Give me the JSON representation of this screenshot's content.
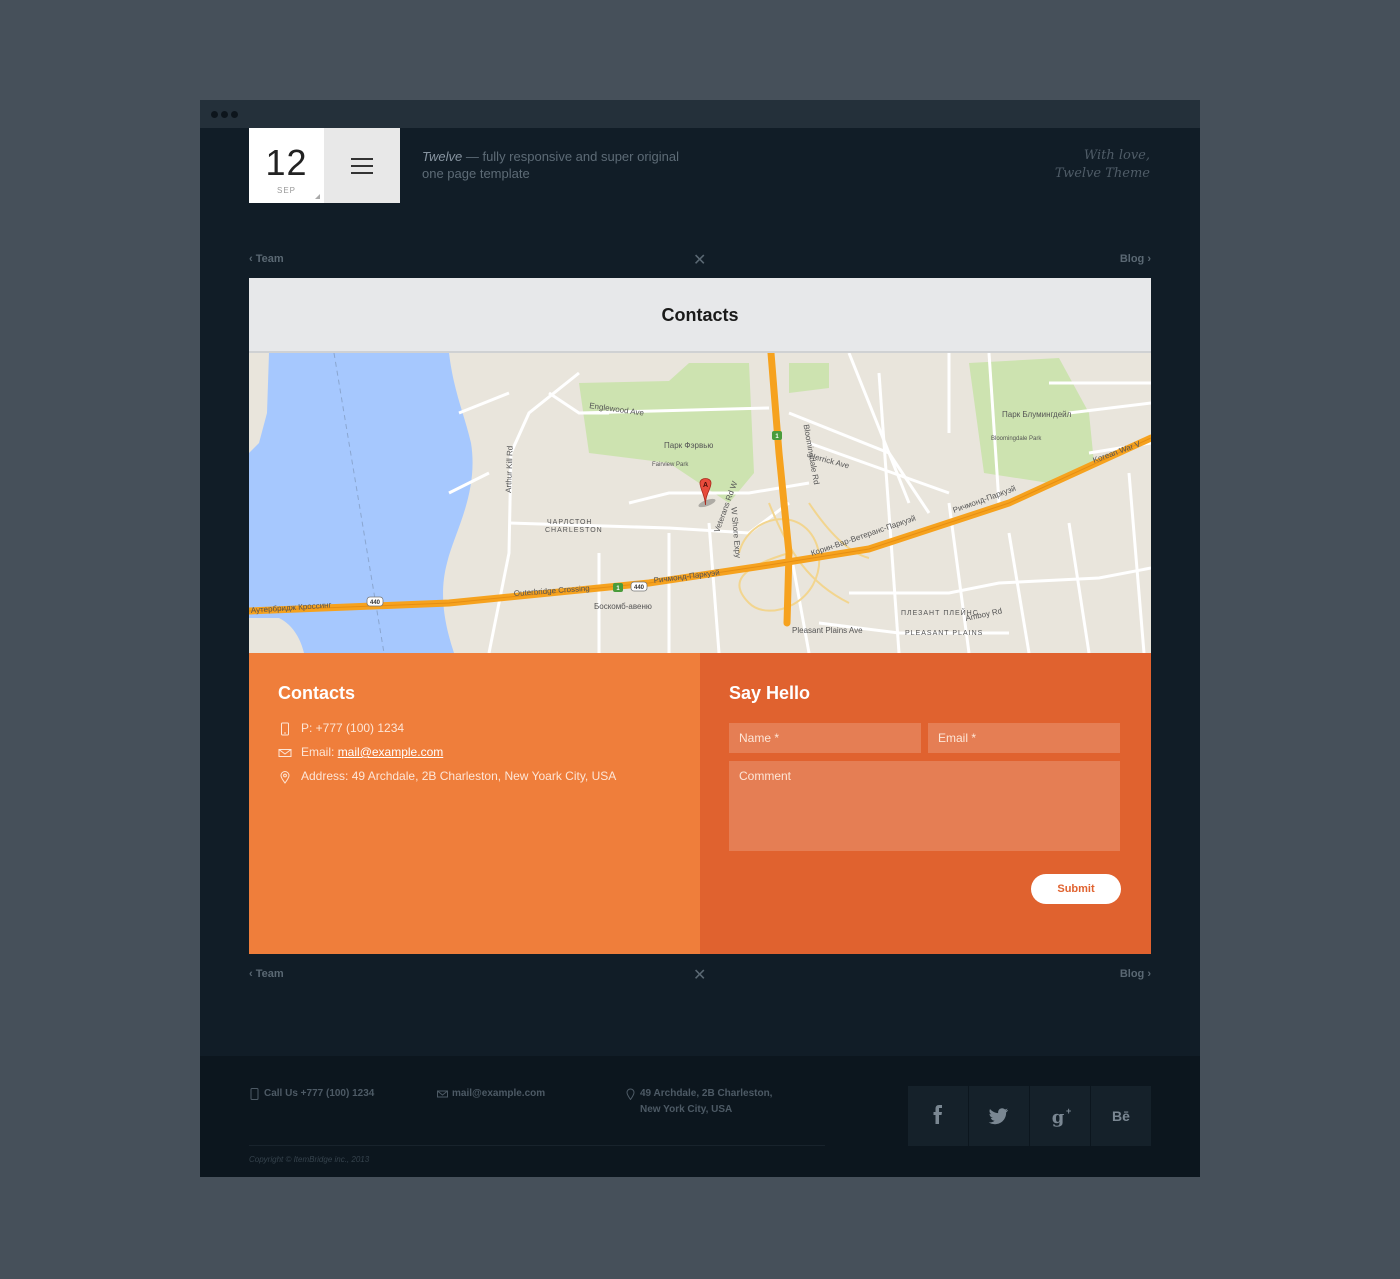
{
  "logo": {
    "day": "12",
    "month": "SEP"
  },
  "tagline": {
    "brand": "Twelve",
    "rest": "— fully responsive and super original one page template"
  },
  "signature": {
    "line1": "With love,",
    "line2": "Twelve Theme"
  },
  "nav": {
    "prev": "Team",
    "next": "Blog"
  },
  "panel": {
    "title": "Contacts"
  },
  "map": {
    "labels": [
      "Ричмонд-Паркуэй",
      "Outerbridge Crossing",
      "Аутербридж Кроссинг",
      "Корин-Вар-Ветеранс-Паркуэй",
      "Ричмонд-Паркуэй",
      "Парк Фэрвью",
      "Fairview Park",
      "ЧАРЛСТОН",
      "CHARLESTON",
      "Парк Блумингдейл",
      "Bloomingdale Park",
      "ПЛЕЗАНТ ПЛЕЙНС",
      "PLEASANT PLAINS",
      "Arthur Kill Rd",
      "Veterans Rd W",
      "W Shore Expy",
      "Bloomingdale Rd",
      "Amboy Rd",
      "Боскомб-авеню",
      "Pleasant Plains Ave",
      "Englewood Ave",
      "Herrick Ave",
      "Korean War V",
      "440",
      "440",
      "1",
      "1"
    ],
    "marker": "A"
  },
  "contacts": {
    "title": "Contacts",
    "phone": "P: +777 (100) 1234",
    "email_label": "Email:",
    "email": "mail@example.com",
    "address": "Address: 49 Archdale, 2B Charleston, New Yoark City, USA"
  },
  "form": {
    "title": "Say Hello",
    "name_placeholder": "Name *",
    "email_placeholder": "Email *",
    "comment_placeholder": "Comment",
    "submit": "Submit"
  },
  "footer": {
    "phone": "Call Us +777 (100) 1234",
    "email": "mail@example.com",
    "address1": "49 Archdale, 2B Charleston,",
    "address2": "New York City, USA",
    "copyright": "Copyright © ItemBridge inc., 2013",
    "socials": [
      "f",
      "twitter-bird",
      "g+",
      "Bē"
    ]
  }
}
